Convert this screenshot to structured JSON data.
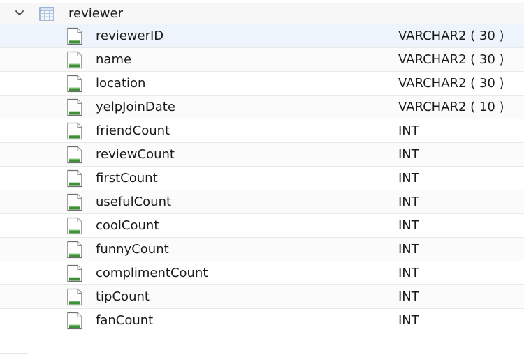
{
  "tree": {
    "table": {
      "name": "reviewer",
      "expanded": true,
      "icon": "table-icon",
      "chevron_icon": "chevron-down-icon"
    },
    "columns": [
      {
        "name": "reviewerID",
        "type": "VARCHAR2 ( 30 )"
      },
      {
        "name": "name",
        "type": "VARCHAR2 ( 30 )"
      },
      {
        "name": "location",
        "type": "VARCHAR2 ( 30 )"
      },
      {
        "name": "yelpJoinDate",
        "type": "VARCHAR2 ( 10 )"
      },
      {
        "name": "friendCount",
        "type": "INT"
      },
      {
        "name": "reviewCount",
        "type": "INT"
      },
      {
        "name": "firstCount",
        "type": "INT"
      },
      {
        "name": "usefulCount",
        "type": "INT"
      },
      {
        "name": "coolCount",
        "type": "INT"
      },
      {
        "name": "funnyCount",
        "type": "INT"
      },
      {
        "name": "complimentCount",
        "type": "INT"
      },
      {
        "name": "tipCount",
        "type": "INT"
      },
      {
        "name": "fanCount",
        "type": "INT"
      }
    ],
    "column_icon": "column-icon",
    "selected_index": 0
  },
  "colors": {
    "selected_row": "#eef4fb",
    "icon_green": "#3f8f3a",
    "icon_blue": "#2f6db5",
    "text": "#1a1a1a"
  }
}
